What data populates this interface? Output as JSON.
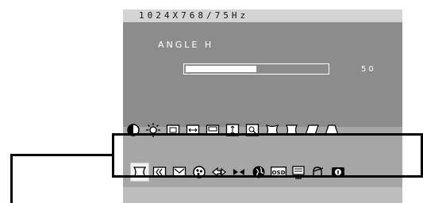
{
  "header": {
    "resolution": "1024X768/75Hz"
  },
  "osd": {
    "title": "ANGLE H",
    "slider": {
      "value": 50,
      "display": "50",
      "max": 100
    }
  },
  "icons": {
    "main_row": [
      "contrast-icon",
      "brightness-icon",
      "h-position-icon",
      "h-size-icon",
      "v-position-icon",
      "v-size-icon",
      "zoom-icon",
      "pincushion-icon",
      "pin-balance-icon",
      "parallelogram-icon",
      "trapezoid-icon"
    ],
    "sub_row": [
      "angle-h-icon",
      "degauss-icon",
      "color-icon",
      "color-temp-icon",
      "input-icon",
      "moire-icon",
      "language-icon",
      "osd-icon",
      "osd-position-icon",
      "recall-icon",
      "info-icon"
    ],
    "selected_sub": "angle-h-icon"
  },
  "colors": {
    "panel": "#8c8c8c",
    "lower": "#a6a6a6",
    "strip": "#bdbdbd",
    "text": "#ffffff"
  }
}
